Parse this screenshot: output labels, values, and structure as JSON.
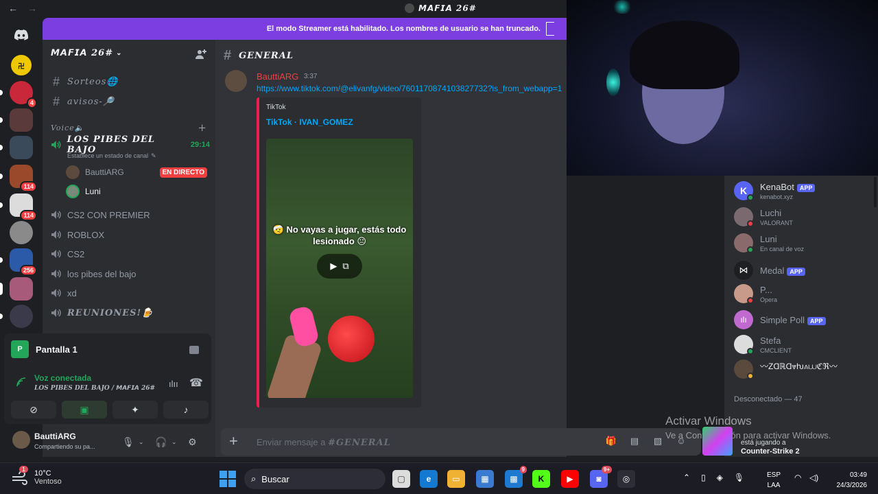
{
  "window": {
    "title": "𝙈𝘼𝙁𝙄𝘼 26#"
  },
  "banner": {
    "text": "El modo Streamer está habilitado. Los nombres de usuario se han truncado."
  },
  "servers": [
    {
      "badge": ""
    },
    {
      "badge": ""
    },
    {
      "badge": "4"
    },
    {
      "badge": ""
    },
    {
      "badge": ""
    },
    {
      "badge": "114"
    },
    {
      "badge": "114"
    },
    {
      "badge": ""
    },
    {
      "badge": "256"
    },
    {
      "badge": ""
    },
    {
      "badge": ""
    }
  ],
  "sidebar": {
    "guild_name": "𝙈𝘼𝙁𝙄𝘼 26#",
    "text_channels": [
      {
        "name": "Sorteos🌐"
      },
      {
        "name": "avisos-🔎"
      }
    ],
    "voice_section": "Voice🔈",
    "voice_channels": [
      {
        "name": "LOS PIBES DEL BAJO",
        "timer": "29:14",
        "status": "Establece un estado de canal"
      },
      {
        "name": "CS2 CON PREMIER"
      },
      {
        "name": "ROBLOX"
      },
      {
        "name": "CS2"
      },
      {
        "name": "los pibes del bajo"
      },
      {
        "name": "xd"
      },
      {
        "name": "REUNIONES!🍺"
      }
    ],
    "voice_users": [
      {
        "name": "BauttiARG",
        "live": "EN DIRECTO"
      },
      {
        "name": "Luni"
      }
    ]
  },
  "voice_panel": {
    "stream_title": "Pantalla 1",
    "connected": "Voz conectada",
    "channel": "LOS PIBES DEL BAJO / 𝙈𝘼𝙁𝙄𝘼 26#"
  },
  "user": {
    "name": "BauttiARG",
    "status": "Compartiendo su pa..."
  },
  "chat": {
    "channel": "GENERAL",
    "message": {
      "author": "BauttiARG",
      "time": "3:37",
      "link": "https://www.tiktok.com/@elivanfg/video/7601170874103827732?is_from_webapp=1",
      "embed": {
        "provider": "TikTok",
        "title": "TikTok · IVAN_GOMEZ",
        "caption": "🤕 No vayas a jugar, estás todo lesionado 😐"
      }
    },
    "composer_placeholder_prefix": "Enviar mensaje a ",
    "composer_placeholder_channel": "#GENERAL"
  },
  "members": [
    {
      "name": "KenaBot",
      "tag": "APP",
      "sub": "kenabot.xyz",
      "color": "#5865f2",
      "status": "#23a55a"
    },
    {
      "name": "Luchi",
      "tag": "",
      "sub": "VALORANT",
      "color": "#7a6a70",
      "status": "#f23f42"
    },
    {
      "name": "Luni",
      "tag": "",
      "sub": "En canal de voz",
      "color": "#8a6a6a",
      "status": "#23a55a"
    },
    {
      "name": "Medal",
      "tag": "APP",
      "sub": "",
      "color": "#1e1f22",
      "status": ""
    },
    {
      "name": "P...",
      "tag": "",
      "sub": "Opera",
      "color": "#c89a8a",
      "status": "#f23f42"
    },
    {
      "name": "Simple Poll",
      "tag": "APP",
      "sub": "",
      "color": "#c06ad0",
      "status": ""
    },
    {
      "name": "Stefa",
      "tag": "",
      "sub": "CMCLIENT",
      "color": "#dcdcdc",
      "status": "#23a55a"
    },
    {
      "name": "〰ZⱭℝⱭ⩔ƕ⟑⩊ℭℜ〰",
      "tag": "",
      "sub": "",
      "color": "#5a4a3e",
      "status": "#f0b232"
    }
  ],
  "members_offline": "Desconectado — 47",
  "overlay": {
    "activate": "Activar Windows",
    "activate_sub": "Ve a Configuración para activar Windows."
  },
  "game_popup": {
    "line1": "está jugando a",
    "line2": "Counter-Strike 2"
  },
  "taskbar": {
    "temp": "10°C",
    "weather": "Ventoso",
    "search": "Buscar",
    "lang1": "ESP",
    "lang2": "LAA",
    "time": "03:49",
    "date": "24/3/2026",
    "weather_badge": "1"
  }
}
